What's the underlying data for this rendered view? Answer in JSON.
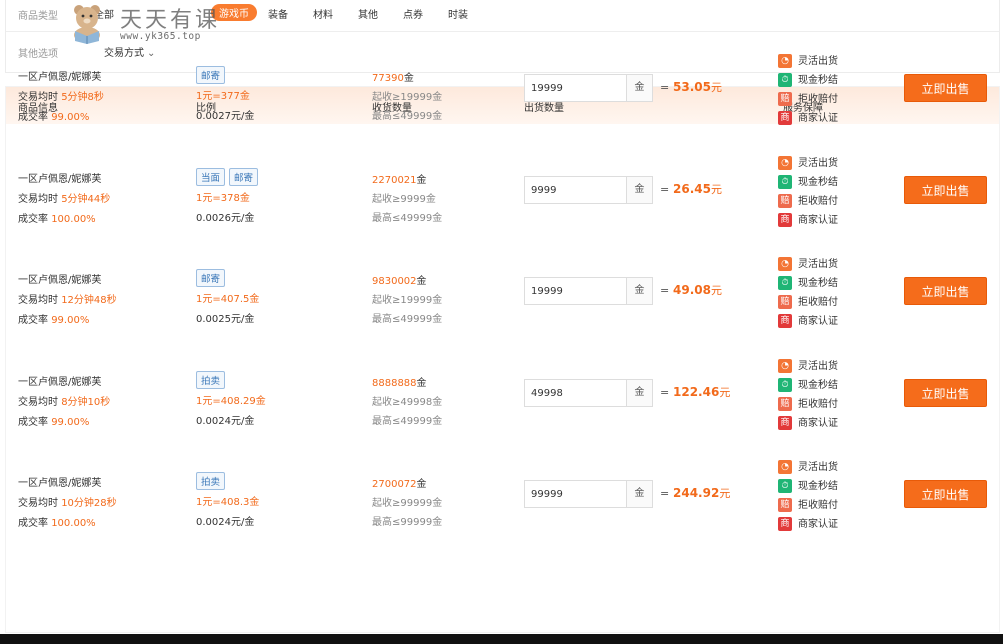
{
  "filter": {
    "type_label": "商品类型",
    "categories": [
      "全部",
      "游戏币",
      "装备",
      "材料",
      "其他",
      "点券",
      "时装"
    ],
    "active_category": "游戏币",
    "other_label": "其他选项",
    "trade_method": "交易方式"
  },
  "watermark": {
    "title": "天天有课",
    "url": "www.yk365.top"
  },
  "table": {
    "headers": [
      "商品信息",
      "比例",
      "收货数量",
      "出货数量",
      "服务保障"
    ],
    "service_items": [
      "灵活出货",
      "现金秒结",
      "拒收赔付",
      "商家认证"
    ],
    "service_icons": [
      "clock-icon",
      "stopwatch-icon",
      "compensation-icon",
      "merchant-icon"
    ],
    "service_glyphs": [
      "◔",
      "⏱",
      "赔",
      "商"
    ],
    "button_label": "立即出售",
    "gold_unit": "金",
    "yuan": "元",
    "rows": [
      {
        "name": "一区卢佩恩/妮娜芙",
        "time_label": "交易均时 ",
        "time": "5分钟8秒",
        "rate_label": "成交率 ",
        "rate": "99.00%",
        "tags": [
          "邮寄"
        ],
        "ratio": "1元=377金",
        "unit_price": "0.0027元/金",
        "qty": "77390",
        "min": "起收≥19999金",
        "max": "最高≤49999金",
        "input": "19999",
        "price": "53.05"
      },
      {
        "name": "一区卢佩恩/妮娜芙",
        "time_label": "交易均时 ",
        "time": "5分钟44秒",
        "rate_label": "成交率 ",
        "rate": "100.00%",
        "tags": [
          "当面",
          "邮寄"
        ],
        "ratio": "1元=378金",
        "unit_price": "0.0026元/金",
        "qty": "2270021",
        "min": "起收≥9999金",
        "max": "最高≤49999金",
        "input": "9999",
        "price": "26.45"
      },
      {
        "name": "一区卢佩恩/妮娜芙",
        "time_label": "交易均时 ",
        "time": "12分钟48秒",
        "rate_label": "成交率 ",
        "rate": "99.00%",
        "tags": [
          "邮寄"
        ],
        "ratio": "1元=407.5金",
        "unit_price": "0.0025元/金",
        "qty": "9830002",
        "min": "起收≥19999金",
        "max": "最高≤49999金",
        "input": "19999",
        "price": "49.08"
      },
      {
        "name": "一区卢佩恩/妮娜芙",
        "time_label": "交易均时 ",
        "time": "8分钟10秒",
        "rate_label": "成交率 ",
        "rate": "99.00%",
        "tags": [
          "拍卖"
        ],
        "ratio": "1元=408.29金",
        "unit_price": "0.0024元/金",
        "qty": "8888888",
        "min": "起收≥49998金",
        "max": "最高≤49999金",
        "input": "49998",
        "price": "122.46"
      },
      {
        "name": "一区卢佩恩/妮娜芙",
        "time_label": "交易均时 ",
        "time": "10分钟28秒",
        "rate_label": "成交率 ",
        "rate": "100.00%",
        "tags": [
          "拍卖"
        ],
        "ratio": "1元=408.3金",
        "unit_price": "0.0024元/金",
        "qty": "2700072",
        "min": "起收≥99999金",
        "max": "最高≤99999金",
        "input": "99999",
        "price": "244.92"
      }
    ]
  },
  "colors": {
    "accent": "#f56c1b",
    "header_bg": "#fde9dc",
    "tag_border": "#9cbde0"
  }
}
